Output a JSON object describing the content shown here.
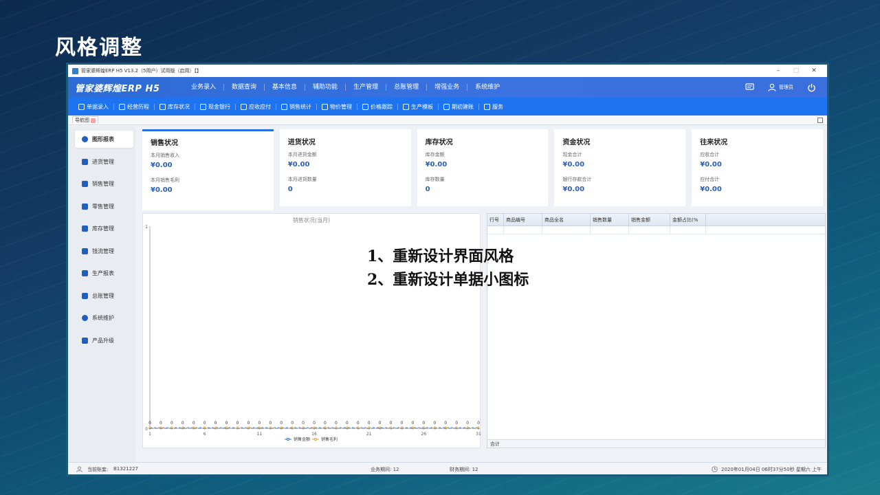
{
  "slide": {
    "title": "风格调整",
    "notes": [
      "1、重新设计界面风格",
      "2、重新设计单据小图标"
    ]
  },
  "window": {
    "title": "管家婆辉煌ERP H5 V13.2（5用户）试用版（启用）【】",
    "controls": {
      "minimize": "–",
      "maximize": "□",
      "close": "✕"
    }
  },
  "brand": "管家婆辉煌ERP H5",
  "menu": [
    "业务录入",
    "数据查询",
    "基本信息",
    "辅助功能",
    "生产管理",
    "总账管理",
    "增强业务",
    "系统维护"
  ],
  "user": {
    "label": "管理员"
  },
  "subnav": [
    "单据录入",
    "经营历程",
    "库存状况",
    "现金银行",
    "应收应付",
    "销售统计",
    "物价管理",
    "价格跟踪",
    "生产模板",
    "期初建账",
    "服务"
  ],
  "navtab": {
    "label": "导航图"
  },
  "sidebar": [
    "图形报表",
    "进货管理",
    "销售管理",
    "零售管理",
    "库存管理",
    "钱流管理",
    "生产报表",
    "总账管理",
    "系统维护",
    "产品升级"
  ],
  "cards": [
    {
      "title": "销售状况",
      "fields": [
        {
          "label": "本月销售收入",
          "value": "¥0.00"
        },
        {
          "label": "本月销售毛利",
          "value": "¥0.00"
        }
      ]
    },
    {
      "title": "进货状况",
      "fields": [
        {
          "label": "本月进货金额",
          "value": "¥0.00"
        },
        {
          "label": "本月进货数量",
          "value": "0"
        }
      ]
    },
    {
      "title": "库存状况",
      "fields": [
        {
          "label": "库存金额",
          "value": "¥0.00"
        },
        {
          "label": "库存数量",
          "value": "0"
        }
      ]
    },
    {
      "title": "资金状况",
      "fields": [
        {
          "label": "现金合计",
          "value": "¥0.00"
        },
        {
          "label": "银行存款合计",
          "value": "¥0.00"
        }
      ]
    },
    {
      "title": "往来状况",
      "fields": [
        {
          "label": "应收合计",
          "value": "¥0.00"
        },
        {
          "label": "应付合计",
          "value": "¥0.00"
        }
      ]
    }
  ],
  "table": {
    "headers": [
      "行号",
      "商品编号",
      "商品全名",
      "销售数量",
      "销售金额",
      "金额占比(%"
    ],
    "footer": "合计"
  },
  "chart_data": {
    "type": "line",
    "title": "销售状况(当月)",
    "x": [
      1,
      2,
      3,
      4,
      5,
      6,
      7,
      8,
      9,
      10,
      11,
      12,
      13,
      14,
      15,
      16,
      17,
      18,
      19,
      20,
      21,
      22,
      23,
      24,
      25,
      26,
      27,
      28,
      29,
      30,
      31
    ],
    "xticks": [
      1,
      6,
      11,
      16,
      21,
      26,
      31
    ],
    "ylim": [
      0,
      1
    ],
    "yticks": [
      0,
      1
    ],
    "series": [
      {
        "name": "销售金额",
        "color": "#2a6fdf",
        "values": [
          0,
          0,
          0,
          0,
          0,
          0,
          0,
          0,
          0,
          0,
          0,
          0,
          0,
          0,
          0,
          0,
          0,
          0,
          0,
          0,
          0,
          0,
          0,
          0,
          0,
          0,
          0,
          0,
          0,
          0,
          0
        ]
      },
      {
        "name": "销售毛利",
        "color": "#e0a020",
        "values": [
          0,
          0,
          0,
          0,
          0,
          0,
          0,
          0,
          0,
          0,
          0,
          0,
          0,
          0,
          0,
          0,
          0,
          0,
          0,
          0,
          0,
          0,
          0,
          0,
          0,
          0,
          0,
          0,
          0,
          0,
          0
        ]
      }
    ],
    "point_label": "0",
    "legend": "bottom-center"
  },
  "status": {
    "account_label": "当前账套:",
    "account": "B1321227",
    "business_period": "业务期间: 12",
    "finance_period": "财务期间: 12",
    "datetime": "2020年01月04日 06时37分50秒 星期六 上午"
  }
}
